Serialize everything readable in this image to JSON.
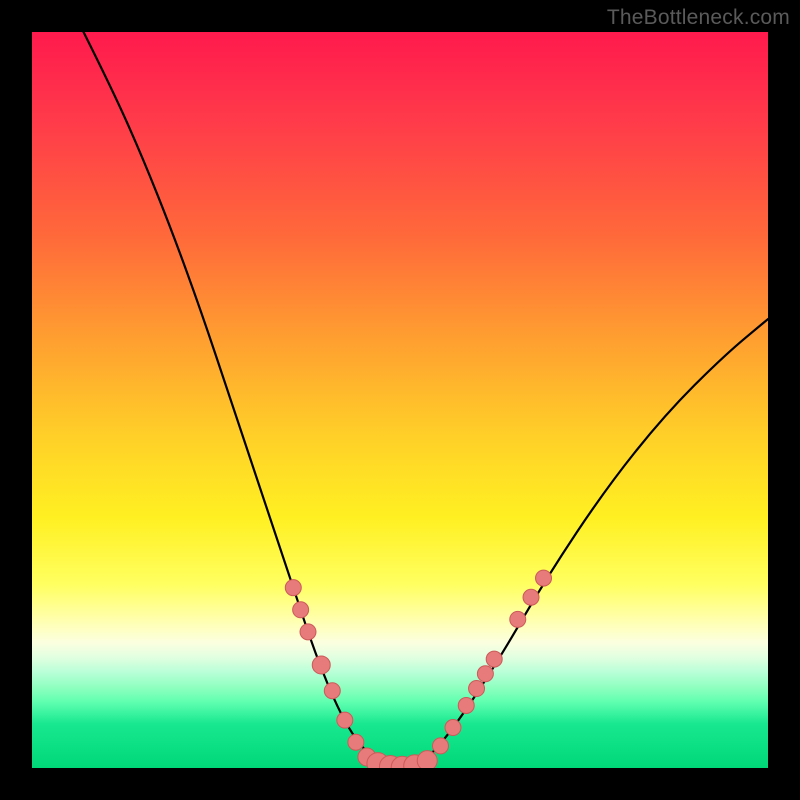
{
  "watermark": "TheBottleneck.com",
  "chart_data": {
    "type": "line",
    "title": "",
    "xlabel": "",
    "ylabel": "",
    "ylim": [
      0,
      100
    ],
    "curve": {
      "name": "bottleneck-curve",
      "color": "#000000",
      "points": [
        {
          "x": 0.07,
          "y": 1.0
        },
        {
          "x": 0.11,
          "y": 0.92
        },
        {
          "x": 0.15,
          "y": 0.83
        },
        {
          "x": 0.19,
          "y": 0.73
        },
        {
          "x": 0.23,
          "y": 0.62
        },
        {
          "x": 0.27,
          "y": 0.5
        },
        {
          "x": 0.31,
          "y": 0.38
        },
        {
          "x": 0.35,
          "y": 0.26
        },
        {
          "x": 0.39,
          "y": 0.14
        },
        {
          "x": 0.43,
          "y": 0.05
        },
        {
          "x": 0.47,
          "y": 0.005
        },
        {
          "x": 0.5,
          "y": 0.0
        },
        {
          "x": 0.53,
          "y": 0.005
        },
        {
          "x": 0.57,
          "y": 0.05
        },
        {
          "x": 0.63,
          "y": 0.14
        },
        {
          "x": 0.7,
          "y": 0.26
        },
        {
          "x": 0.78,
          "y": 0.38
        },
        {
          "x": 0.86,
          "y": 0.48
        },
        {
          "x": 0.94,
          "y": 0.56
        },
        {
          "x": 1.0,
          "y": 0.61
        }
      ]
    },
    "markers": {
      "color": "#e77a7a",
      "stroke": "#cc5a5a",
      "radius_small": 8,
      "radius_large": 12,
      "points": [
        {
          "x": 0.355,
          "y": 0.245,
          "r": 8
        },
        {
          "x": 0.365,
          "y": 0.215,
          "r": 8
        },
        {
          "x": 0.375,
          "y": 0.185,
          "r": 8
        },
        {
          "x": 0.393,
          "y": 0.14,
          "r": 9
        },
        {
          "x": 0.408,
          "y": 0.105,
          "r": 8
        },
        {
          "x": 0.425,
          "y": 0.065,
          "r": 8
        },
        {
          "x": 0.44,
          "y": 0.035,
          "r": 8
        },
        {
          "x": 0.455,
          "y": 0.015,
          "r": 9
        },
        {
          "x": 0.47,
          "y": 0.006,
          "r": 11
        },
        {
          "x": 0.487,
          "y": 0.002,
          "r": 11
        },
        {
          "x": 0.503,
          "y": 0.001,
          "r": 11
        },
        {
          "x": 0.52,
          "y": 0.003,
          "r": 11
        },
        {
          "x": 0.537,
          "y": 0.01,
          "r": 10
        },
        {
          "x": 0.555,
          "y": 0.03,
          "r": 8
        },
        {
          "x": 0.572,
          "y": 0.055,
          "r": 8
        },
        {
          "x": 0.59,
          "y": 0.085,
          "r": 8
        },
        {
          "x": 0.604,
          "y": 0.108,
          "r": 8
        },
        {
          "x": 0.616,
          "y": 0.128,
          "r": 8
        },
        {
          "x": 0.628,
          "y": 0.148,
          "r": 8
        },
        {
          "x": 0.66,
          "y": 0.202,
          "r": 8
        },
        {
          "x": 0.678,
          "y": 0.232,
          "r": 8
        },
        {
          "x": 0.695,
          "y": 0.258,
          "r": 8
        }
      ]
    }
  }
}
